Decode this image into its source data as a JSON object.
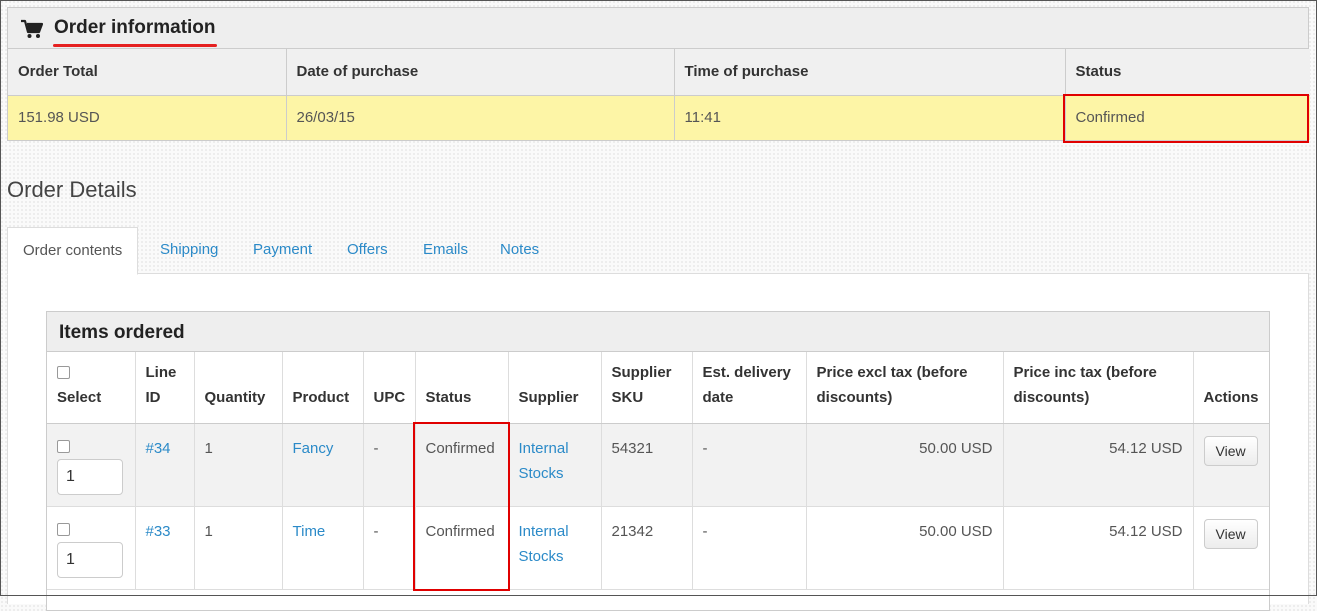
{
  "order_info": {
    "title": "Order information",
    "columns": [
      "Order Total",
      "Date of purchase",
      "Time of purchase",
      "Status"
    ],
    "values": [
      "151.98 USD",
      "26/03/15",
      "11:41",
      "Confirmed"
    ]
  },
  "details_title": "Order Details",
  "tabs": [
    "Order contents",
    "Shipping",
    "Payment",
    "Offers",
    "Emails",
    "Notes"
  ],
  "items": {
    "title": "Items ordered",
    "columns": [
      "Select",
      "Line ID",
      "Quantity",
      "Product",
      "UPC",
      "Status",
      "Supplier",
      "Supplier SKU",
      "Est. delivery date",
      "Price excl tax (before discounts)",
      "Price inc tax (before discounts)",
      "Actions"
    ],
    "rows": [
      {
        "qty_input": "1",
        "line_id": "#34",
        "quantity": "1",
        "product": "Fancy",
        "upc": "-",
        "status": "Confirmed",
        "supplier": "Internal Stocks",
        "sku": "54321",
        "est_delivery": "-",
        "price_excl": "50.00 USD",
        "price_inc": "54.12 USD",
        "action": "View"
      },
      {
        "qty_input": "1",
        "line_id": "#33",
        "quantity": "1",
        "product": "Time",
        "upc": "-",
        "status": "Confirmed",
        "supplier": "Internal Stocks",
        "sku": "21342",
        "est_delivery": "-",
        "price_excl": "50.00 USD",
        "price_inc": "54.12 USD",
        "action": "View"
      }
    ]
  },
  "colors": {
    "accent": "#2b8ac8",
    "highlight_red": "#e00000",
    "order_row_bg": "#fdf5a6"
  },
  "icons": {
    "cart": "shopping-cart-icon"
  }
}
